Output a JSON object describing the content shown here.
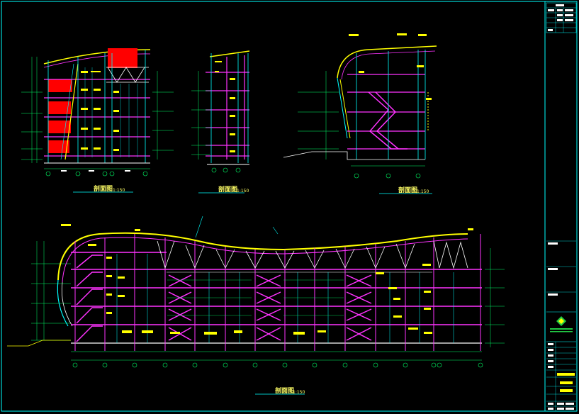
{
  "drawing": {
    "background": "#000000",
    "colors": {
      "frame": "#00ffff",
      "structure": "#ff33ff",
      "roof": "#ffff00",
      "dim": "#00ff66",
      "red": "#ff0000",
      "white": "#ffffff"
    }
  },
  "sections": [
    {
      "title": "剖面图",
      "scale": "1:150"
    },
    {
      "title": "剖面图",
      "scale": "1:150"
    },
    {
      "title": "剖面图",
      "scale": "1:150"
    },
    {
      "title": "剖面图",
      "scale": "1:150"
    }
  ],
  "title_block": {
    "logo": "diamond-logo"
  }
}
